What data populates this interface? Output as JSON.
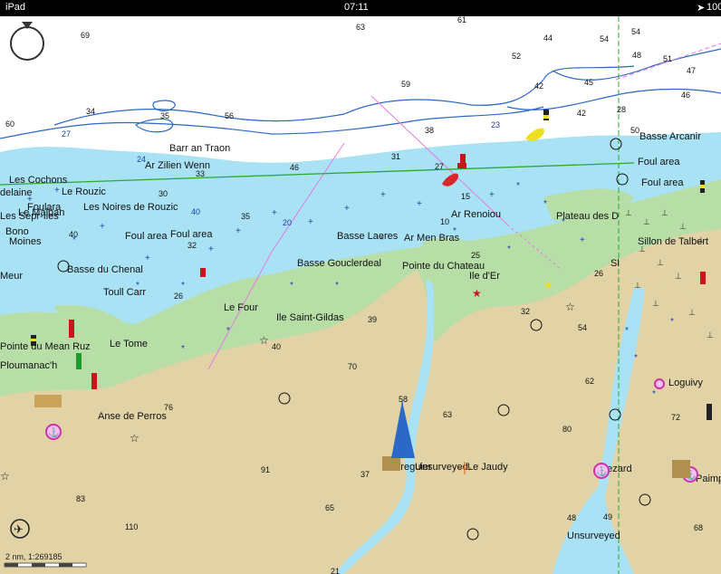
{
  "status_bar": {
    "device": "iPad",
    "time": "07:11",
    "battery": "100"
  },
  "place_labels": [
    "Les Cochons",
    "delaine",
    "Le Rouzic",
    "Foulara",
    "Le Malban",
    "Les Noires de Rouzic",
    "Les Sepr-Iles",
    "Bono",
    "Moines",
    "Barr an Traon",
    "Ar Zilien Wenn",
    "Foul area",
    "Foul area",
    "Meur",
    "Basse du Chenal",
    "Toull Carr",
    "Le Four",
    "Ile Saint-Gildas",
    "Basse Laeres",
    "Ar Men Bras",
    "Basse Gouclerdeal",
    "Pointe du Chateau",
    "Ile d'Er",
    "Ar Renoiou",
    "Plateau des D",
    "Sillon de Talbert",
    "Basse Arcanir",
    "Foul area",
    "Foul area",
    "Pointe du Mean Ruz",
    "Le Tome",
    "Ploumanac'h",
    "Anse de Perros",
    "Treguier",
    "Unsurveyed",
    "Le Jaudy",
    "Loguivy",
    "Lezard",
    "Unsurveyed",
    "Paimpol",
    "Sl"
  ],
  "soundings": [
    "69",
    "63",
    "61",
    "44",
    "54",
    "54",
    "48",
    "51",
    "47",
    "52",
    "45",
    "42",
    "46",
    "59",
    "60",
    "34",
    "35",
    "56",
    "38",
    "23",
    "42",
    "28",
    "50",
    "27",
    "24",
    "46",
    "33",
    "31",
    "27",
    "15",
    "30",
    "40",
    "35",
    "20",
    "32",
    "40",
    "10",
    "25",
    "26",
    "39",
    "32",
    "54",
    "26",
    "40",
    "70",
    "58",
    "63",
    "76",
    "62",
    "72",
    "80",
    "91",
    "37",
    "65",
    "83",
    "110",
    "21",
    "68",
    "48",
    "49"
  ],
  "scale_text": "2 nm, 1:269185",
  "colors": {
    "deep_water": "#ffffff",
    "shallow_water": "#a8e2f4",
    "drying_area": "#b7dea7",
    "land": "#e1d3a5",
    "depth_contour": "#2c68c7",
    "route": "#2fa82f",
    "cable": "#e57be3",
    "light_sector": "#eedf20",
    "buoy_red": "#c8161d",
    "buoy_green": "#1e9b2c",
    "harbour": "#cc33aa"
  },
  "icons": [
    "compass-icon",
    "airport-icon",
    "harbour-icon",
    "light-star-icon",
    "buoy-icon",
    "anchor-icon"
  ]
}
